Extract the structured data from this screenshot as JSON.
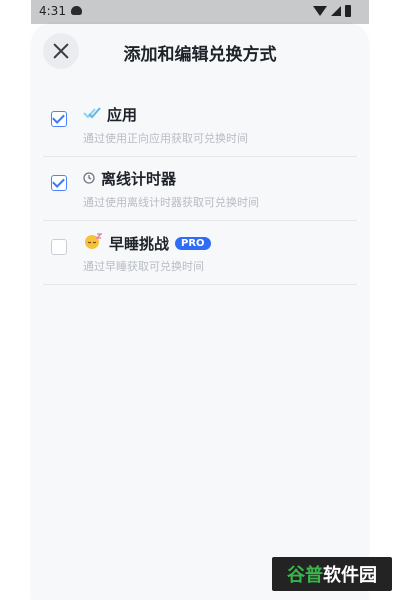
{
  "status_bar": {
    "time": "4:31"
  },
  "sheet": {
    "title": "添加和编辑兑换方式",
    "options": [
      {
        "label": "应用",
        "subtitle": "通过使用正向应用获取可兑换时间",
        "checked": true,
        "icon": "double-check-icon"
      },
      {
        "label": "离线计时器",
        "subtitle": "通过使用离线计时器获取可兑换时间",
        "checked": true,
        "icon": "timer-icon"
      },
      {
        "label": "早睡挑战",
        "subtitle": "通过早睡获取可兑换时间",
        "checked": false,
        "icon": "sleeping-face-icon",
        "badge": "PRO"
      }
    ]
  },
  "watermark": {
    "part1": "谷普",
    "part2": "软件园"
  },
  "colors": {
    "accent": "#2f6df6",
    "checkbox": "#3c78f0",
    "text": "#1e2329",
    "subtext": "#b7bcc4"
  }
}
